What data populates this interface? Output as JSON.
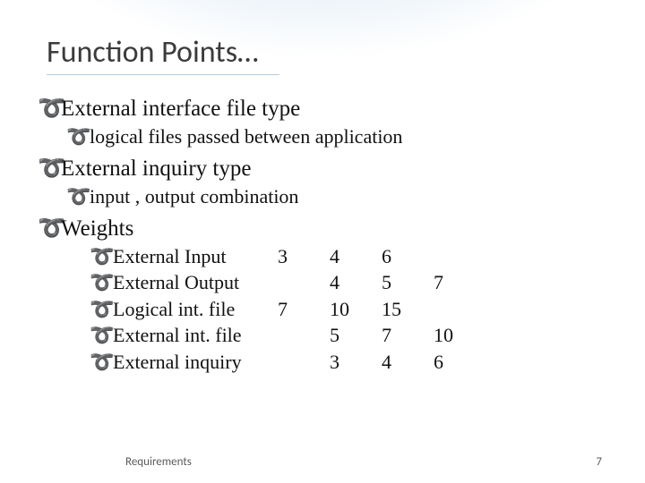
{
  "title": "Function Points…",
  "bullet_glyph": "➰",
  "sections": {
    "eif": {
      "heading": "External interface file type",
      "sub": "logical files passed between application"
    },
    "eit": {
      "heading": "External inquiry type",
      "sub": "input , output combination"
    },
    "weights": {
      "heading": "Weights",
      "rows": [
        {
          "label": "External Input",
          "c1": "3",
          "c2": "4",
          "c3": "6",
          "c4": ""
        },
        {
          "label": "External Output",
          "c1": "",
          "c2": "4",
          "c3": "5",
          "c4": "7"
        },
        {
          "label": "Logical int. file",
          "c1": "7",
          "c2": "10",
          "c3": "15",
          "c4": ""
        },
        {
          "label": "External int. file",
          "c1": "",
          "c2": "5",
          "c3": "7",
          "c4": "10"
        },
        {
          "label": "External inquiry",
          "c1": "",
          "c2": "3",
          "c3": "4",
          "c4": "6"
        }
      ]
    }
  },
  "footer": {
    "left": "Requirements",
    "right": "7"
  }
}
